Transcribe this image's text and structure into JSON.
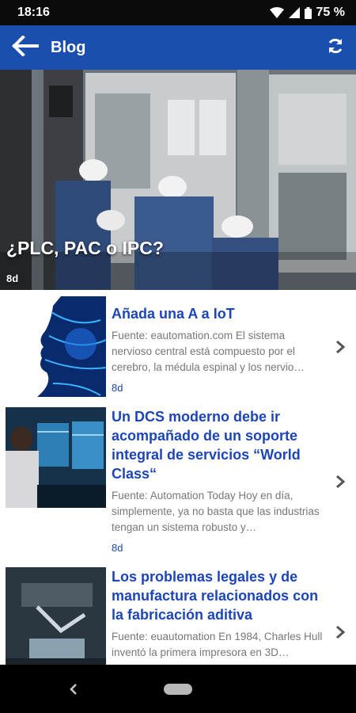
{
  "status": {
    "time": "18:16",
    "battery": "75 %",
    "icons": [
      "wifi-icon",
      "signal-icon",
      "battery-icon"
    ]
  },
  "appbar": {
    "title": "Blog",
    "back_icon": "arrow-left-icon",
    "refresh_icon": "refresh-icon",
    "color": "#1a4fb0"
  },
  "hero": {
    "title": "¿PLC, PAC o IPC?",
    "age": "8d"
  },
  "articles": [
    {
      "title": "Añada una A a IoT",
      "excerpt": "Fuente: eautomation.com El sistema nervioso central está compuesto por el cerebro, la médula espinal y los nervio…",
      "age": "8d"
    },
    {
      "title": "Un DCS moderno debe ir acompañado de un soporte integral de servicios “World Class“",
      "excerpt": "Fuente: Automation Today Hoy en día, simplemente, ya no basta que las industrias tengan un sistema robusto y…",
      "age": "8d"
    },
    {
      "title": "Los problemas legales y de manufactura relacionados con la fabricación aditiva",
      "excerpt": "Fuente: euautomation En 1984, Charles Hull inventó la primera impresora en 3D…"
    }
  ],
  "colors": {
    "link": "#1c46b8",
    "excerpt": "#777777"
  }
}
